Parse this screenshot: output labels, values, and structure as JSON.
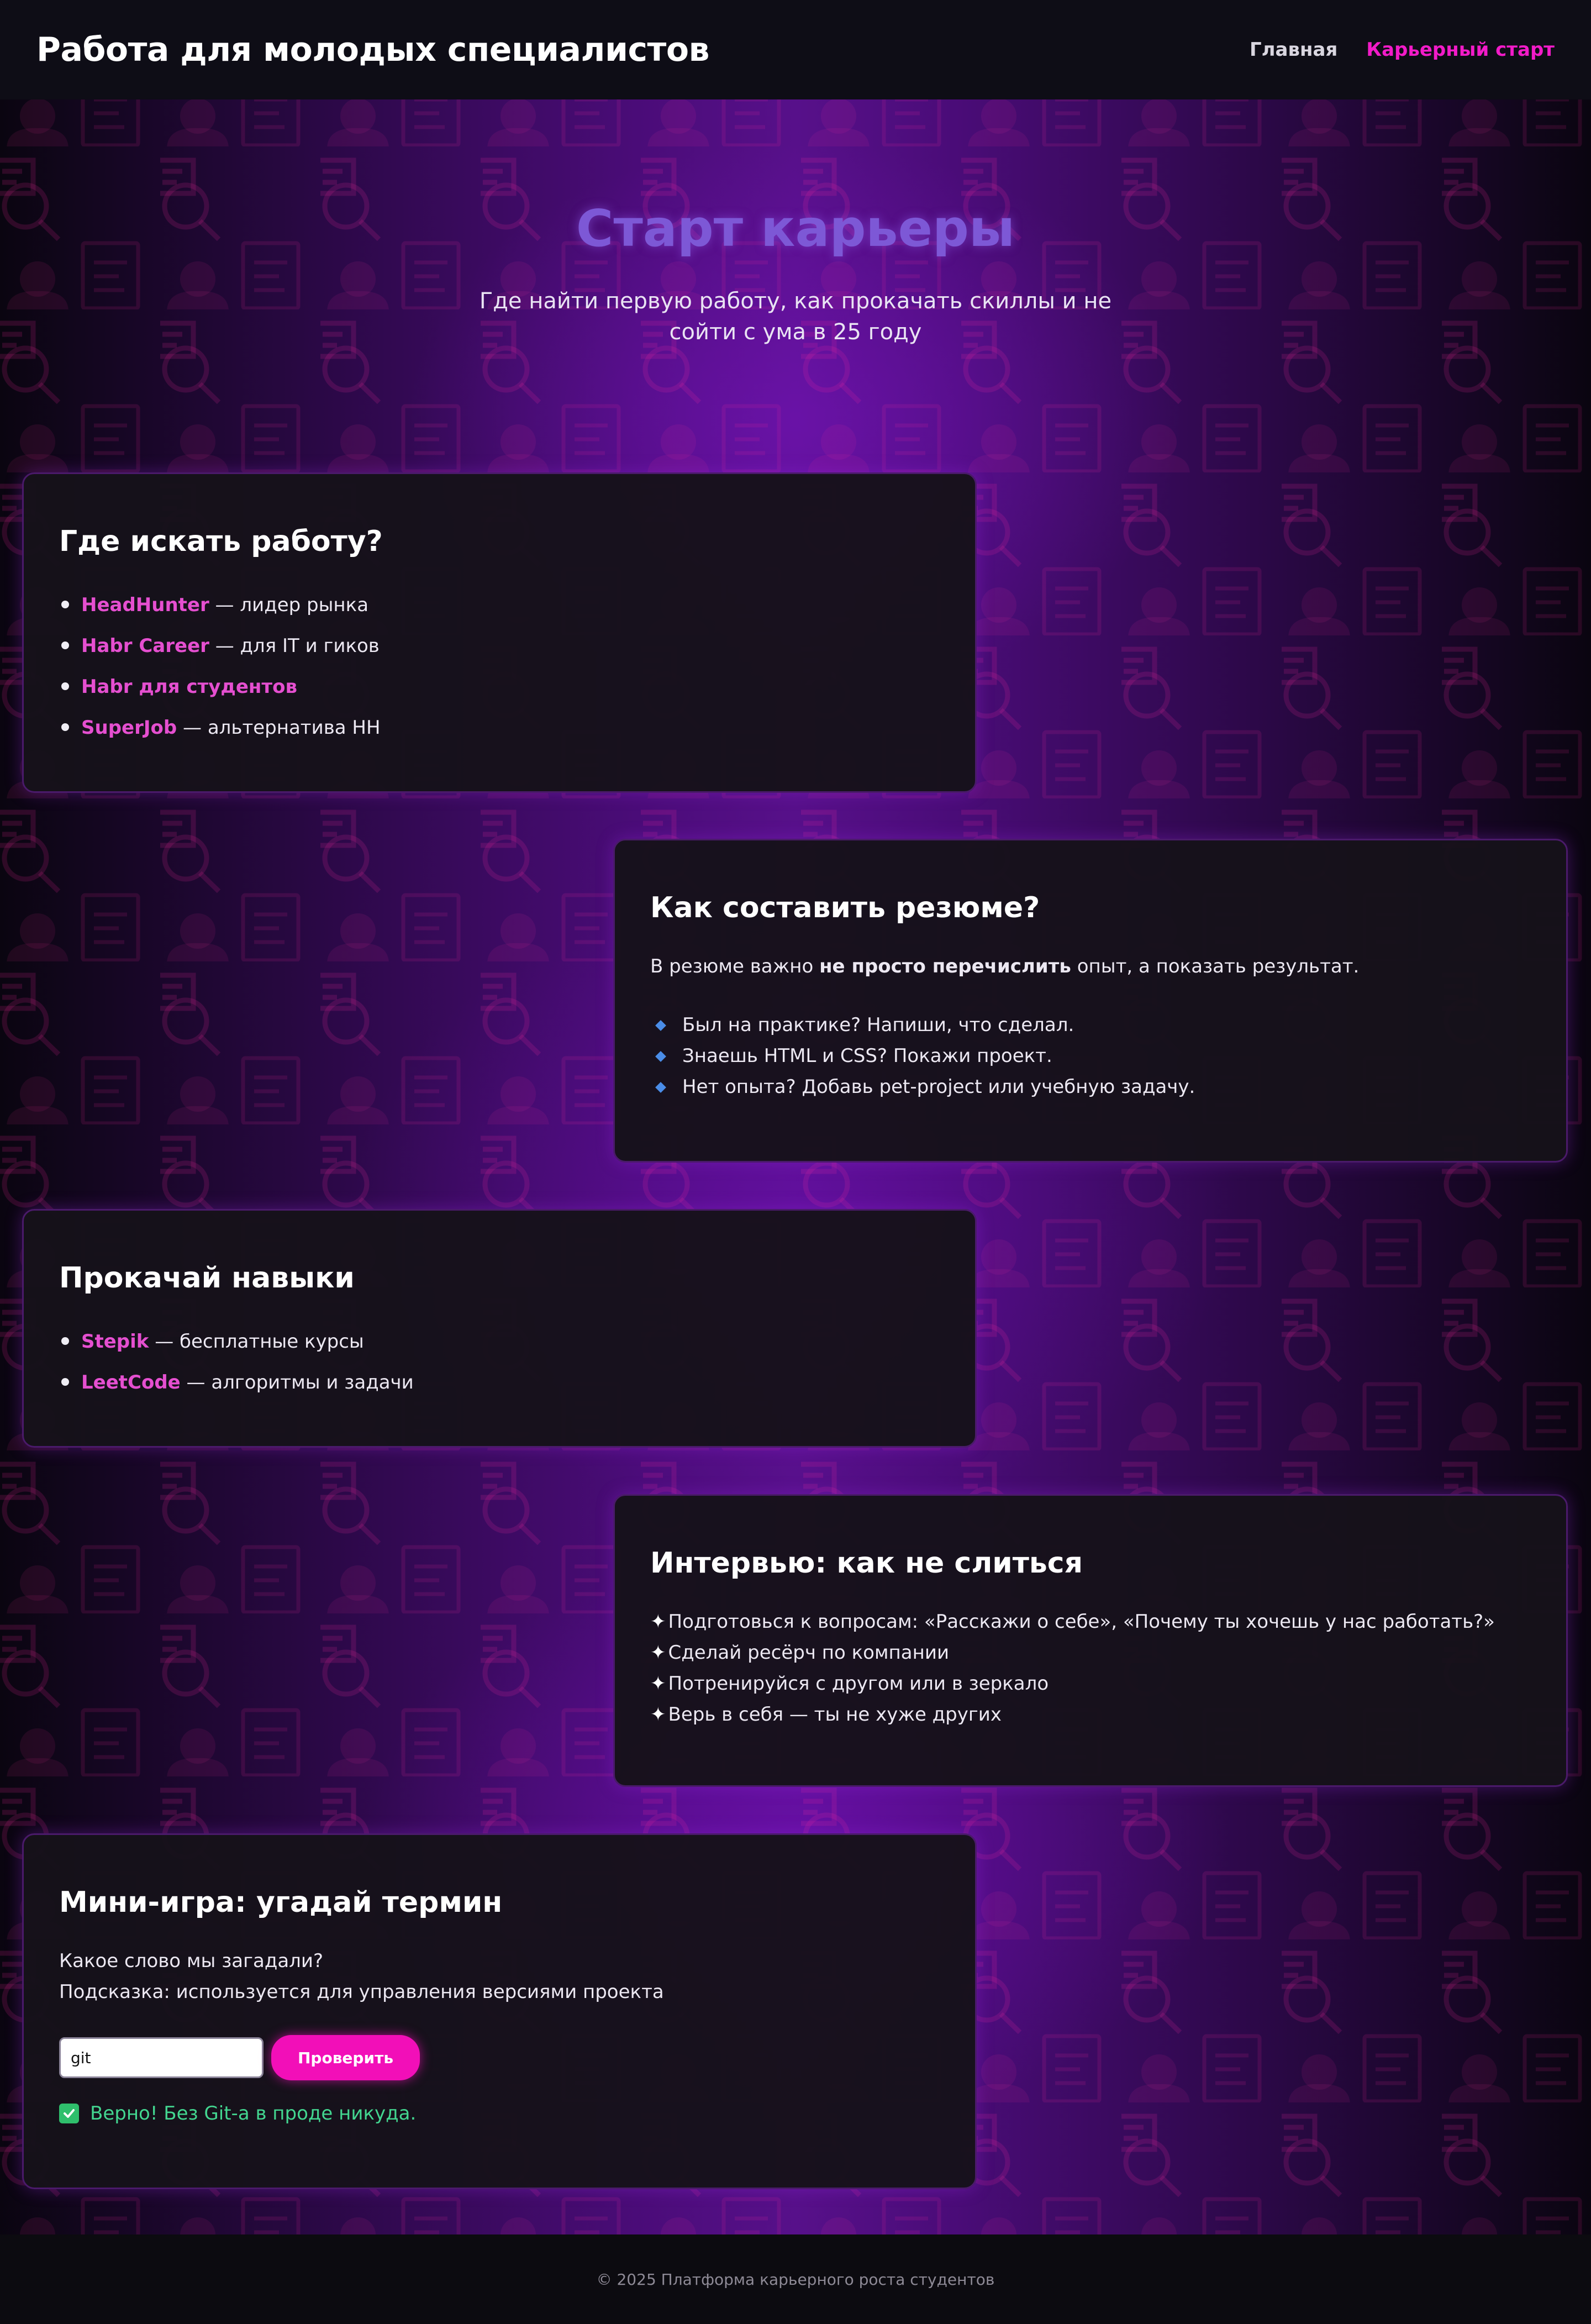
{
  "header": {
    "title": "Работа для молодых специалистов",
    "nav": [
      {
        "label": "Главная"
      },
      {
        "label": "Карьерный старт"
      }
    ]
  },
  "hero": {
    "title": "Старт карьеры",
    "subtitle": "Где найти первую работу, как прокачать скиллы и не сойти с ума в 25 году"
  },
  "sections": {
    "jobs": {
      "title": "Где искать работу?",
      "items": [
        {
          "link": "HeadHunter",
          "rest": " — лидер рынка"
        },
        {
          "link": "Habr Career",
          "rest": " — для IT и гиков"
        },
        {
          "link": "Habr для студентов",
          "rest": ""
        },
        {
          "link": "SuperJob",
          "rest": " — альтернатива HH"
        }
      ]
    },
    "resume": {
      "title": "Как составить резюме?",
      "intro_before": "В резюме важно ",
      "intro_bold": "не просто перечислить",
      "intro_after": " опыт, а показать результат.",
      "items": [
        "Был на практике? Напиши, что сделал.",
        "Знаешь HTML и CSS? Покажи проект.",
        "Нет опыта? Добавь pet-project или учебную задачу."
      ]
    },
    "skills": {
      "title": "Прокачай навыки",
      "items": [
        {
          "link": "Stepik",
          "rest": " — бесплатные курсы"
        },
        {
          "link": "LeetCode",
          "rest": " — алгоритмы и задачи"
        }
      ]
    },
    "interview": {
      "title": "Интервью: как не слиться",
      "star": "✦",
      "items": [
        "Подготовься к вопросам: «Расскажи о себе», «Почему ты хочешь у нас работать?»",
        "Сделай ресёрч по компании",
        "Потренируйся с другом или в зеркало",
        "Верь в себя — ты не хуже других"
      ]
    },
    "game": {
      "title": "Мини-игра: угадай термин",
      "question": "Какое слово мы загадали?",
      "hint": "Подсказка: используется для управления версиями проекта",
      "input_value": "git",
      "button_label": "Проверить",
      "result": "Верно! Без Git-а в проде никуда."
    }
  },
  "footer": {
    "text": "© 2025 Платформа карьерного роста студентов"
  },
  "colors": {
    "accent": "#f21bc8",
    "link": "#e54fd0",
    "hero_title": "#7d58d6",
    "success": "#43d690",
    "bullet_diamond": "#4a8de8"
  }
}
